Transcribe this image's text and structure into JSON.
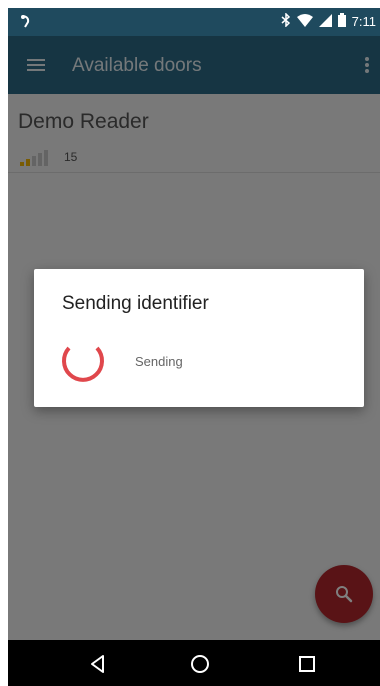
{
  "status_bar": {
    "time": "7:11",
    "icons": [
      "notification-icon",
      "bluetooth-icon",
      "wifi-icon",
      "cell-signal-icon",
      "battery-icon"
    ]
  },
  "app_bar": {
    "title": "Available doors",
    "menu_icon": "hamburger-menu-icon",
    "overflow_icon": "more-vertical-icon"
  },
  "doors": [
    {
      "name": "Demo Reader",
      "signal_value": "15",
      "signal_level": 0.4
    }
  ],
  "dialog": {
    "title": "Sending identifier",
    "message": "Sending"
  },
  "fab": {
    "icon": "search-icon"
  },
  "nav_bar": {
    "icons": [
      "back-icon",
      "home-icon",
      "recents-icon"
    ]
  },
  "colors": {
    "status_bar": "#1f4a5e",
    "app_bar": "#2c6b86",
    "accent": "#e0474c",
    "fab": "#b3272c"
  }
}
